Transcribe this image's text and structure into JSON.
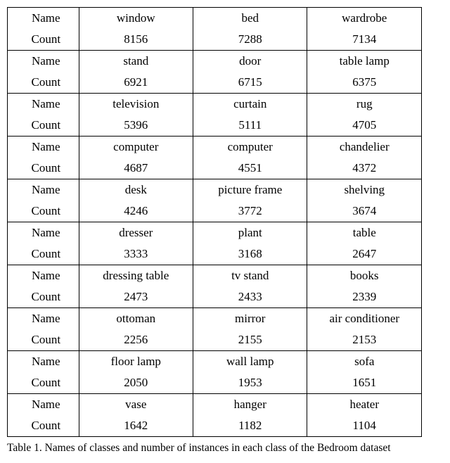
{
  "labels": {
    "name": "Name",
    "count": "Count"
  },
  "chart_data": {
    "type": "table",
    "title": "Names of classes and number of instances in each class of the Bedroom dataset",
    "columns": [
      "Name",
      "Count"
    ],
    "rows": [
      {
        "groupIndex": 0,
        "col": 0,
        "name": "window",
        "count": 8156
      },
      {
        "groupIndex": 0,
        "col": 1,
        "name": "bed",
        "count": 7288
      },
      {
        "groupIndex": 0,
        "col": 2,
        "name": "wardrobe",
        "count": 7134
      },
      {
        "groupIndex": 1,
        "col": 0,
        "name": "stand",
        "count": 6921
      },
      {
        "groupIndex": 1,
        "col": 1,
        "name": "door",
        "count": 6715
      },
      {
        "groupIndex": 1,
        "col": 2,
        "name": "table lamp",
        "count": 6375
      },
      {
        "groupIndex": 2,
        "col": 0,
        "name": "television",
        "count": 5396
      },
      {
        "groupIndex": 2,
        "col": 1,
        "name": "curtain",
        "count": 5111
      },
      {
        "groupIndex": 2,
        "col": 2,
        "name": "rug",
        "count": 4705
      },
      {
        "groupIndex": 3,
        "col": 0,
        "name": "computer",
        "count": 4687
      },
      {
        "groupIndex": 3,
        "col": 1,
        "name": "computer",
        "count": 4551
      },
      {
        "groupIndex": 3,
        "col": 2,
        "name": "chandelier",
        "count": 4372
      },
      {
        "groupIndex": 4,
        "col": 0,
        "name": "desk",
        "count": 4246
      },
      {
        "groupIndex": 4,
        "col": 1,
        "name": "picture frame",
        "count": 3772
      },
      {
        "groupIndex": 4,
        "col": 2,
        "name": "shelving",
        "count": 3674
      },
      {
        "groupIndex": 5,
        "col": 0,
        "name": "dresser",
        "count": 3333
      },
      {
        "groupIndex": 5,
        "col": 1,
        "name": "plant",
        "count": 3168
      },
      {
        "groupIndex": 5,
        "col": 2,
        "name": "table",
        "count": 2647
      },
      {
        "groupIndex": 6,
        "col": 0,
        "name": "dressing table",
        "count": 2473
      },
      {
        "groupIndex": 6,
        "col": 1,
        "name": "tv stand",
        "count": 2433
      },
      {
        "groupIndex": 6,
        "col": 2,
        "name": "books",
        "count": 2339
      },
      {
        "groupIndex": 7,
        "col": 0,
        "name": "ottoman",
        "count": 2256
      },
      {
        "groupIndex": 7,
        "col": 1,
        "name": "mirror",
        "count": 2155
      },
      {
        "groupIndex": 7,
        "col": 2,
        "name": "air conditioner",
        "count": 2153
      },
      {
        "groupIndex": 8,
        "col": 0,
        "name": "floor lamp",
        "count": 2050
      },
      {
        "groupIndex": 8,
        "col": 1,
        "name": "wall lamp",
        "count": 1953
      },
      {
        "groupIndex": 8,
        "col": 2,
        "name": "sofa",
        "count": 1651
      },
      {
        "groupIndex": 9,
        "col": 0,
        "name": "vase",
        "count": 1642
      },
      {
        "groupIndex": 9,
        "col": 1,
        "name": "hanger",
        "count": 1182
      },
      {
        "groupIndex": 9,
        "col": 2,
        "name": "heater",
        "count": 1104
      }
    ]
  },
  "caption": "Table 1. Names of classes and number of instances in each class of the Bedroom dataset"
}
